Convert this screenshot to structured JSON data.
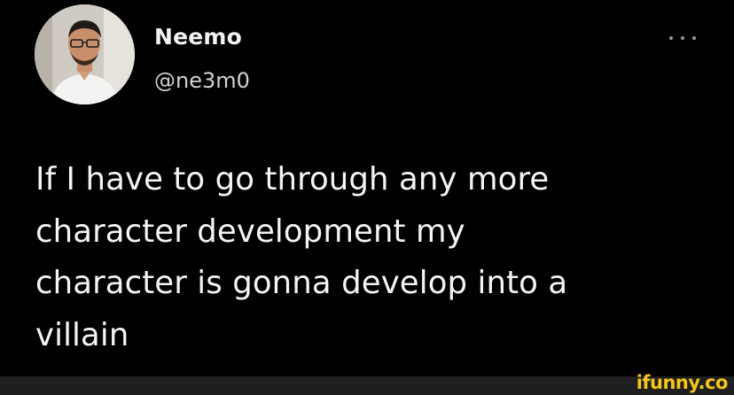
{
  "tweet": {
    "author": {
      "display_name": "Neemo",
      "handle": "@ne3m0"
    },
    "text_lines": [
      "If I have to go through any more",
      "character development my",
      "character is gonna develop into a",
      "villain"
    ]
  },
  "icons": {
    "more": "more-horizontal-icon"
  },
  "watermark": {
    "text": "ifunny.co"
  },
  "colors": {
    "background": "#000000",
    "text_primary": "#f4f4f4",
    "text_secondary": "#d2d2d2",
    "watermark": "#f5c518"
  }
}
